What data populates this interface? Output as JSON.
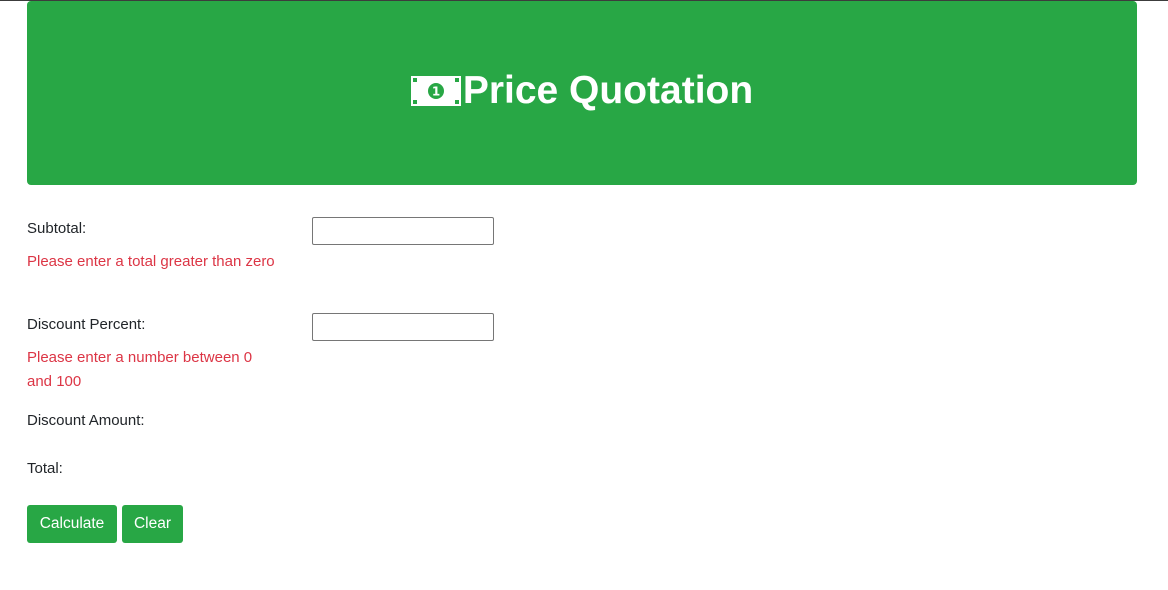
{
  "header": {
    "title": "Price Quotation",
    "icon": "money-bill-icon",
    "color": "#28a745"
  },
  "form": {
    "subtotal": {
      "label": "Subtotal:",
      "value": "",
      "error": "Please enter a total greater than zero"
    },
    "discount_percent": {
      "label": "Discount Percent:",
      "value": "",
      "error": "Please enter a number between 0 and 100"
    },
    "discount_amount": {
      "label": "Discount Amount:",
      "value": ""
    },
    "total": {
      "label": "Total:",
      "value": ""
    }
  },
  "buttons": {
    "calculate_label": "Calculate",
    "clear_label": "Clear"
  },
  "colors": {
    "accent": "#28a745",
    "error": "#dc3545"
  }
}
